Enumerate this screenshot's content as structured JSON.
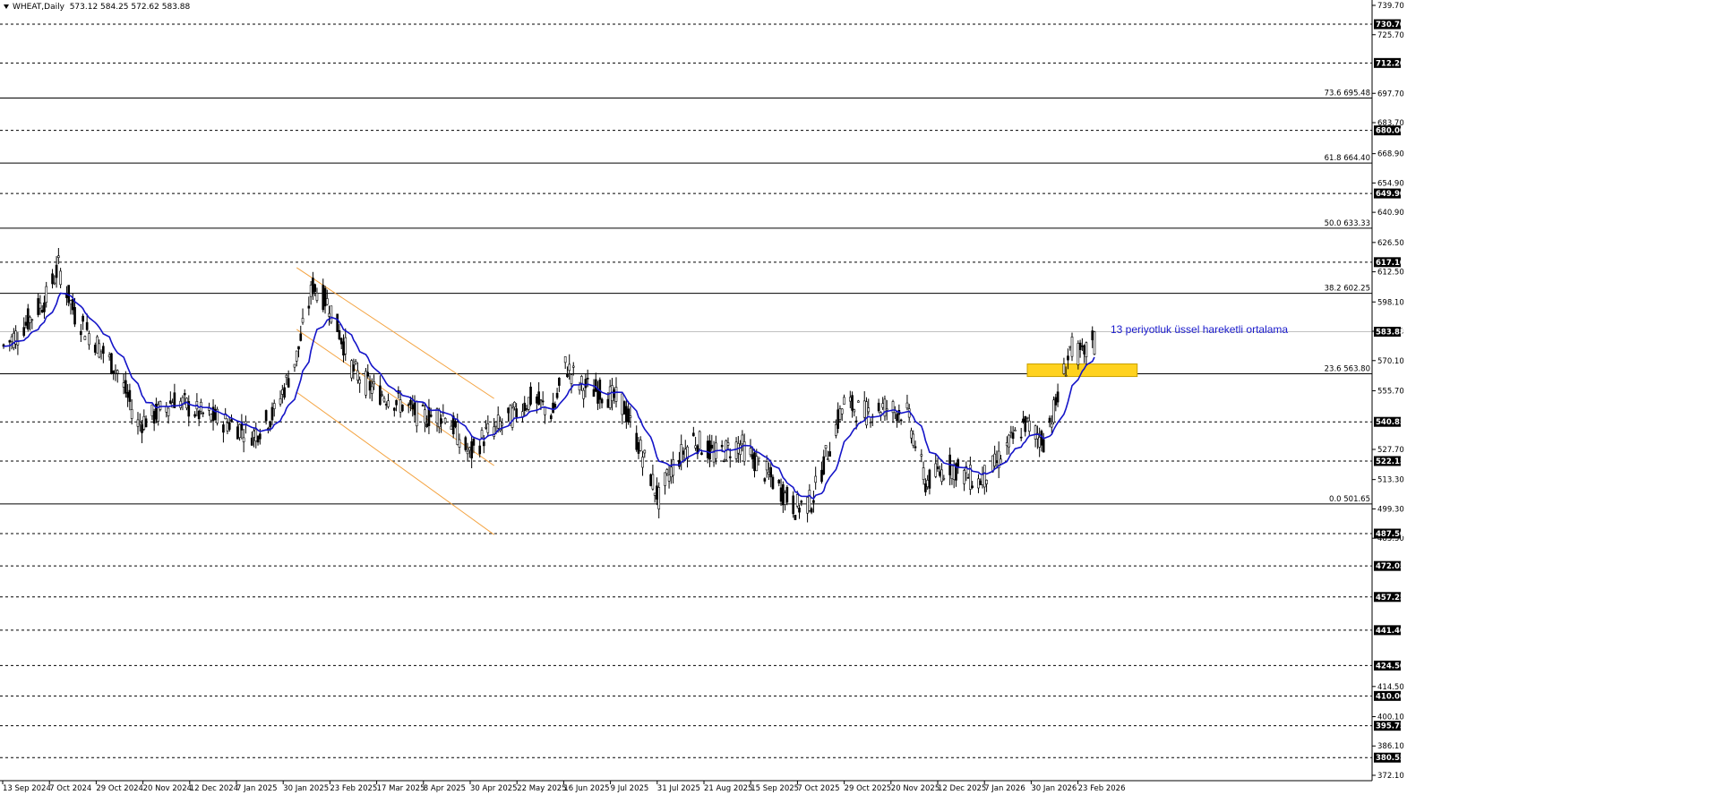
{
  "header": {
    "symbol": "WHEAT,Daily",
    "ohlc": "573.12 584.25 572.62 583.88"
  },
  "annotation": "13 periyotluk üssel hareketli ortalama",
  "colors": {
    "candles": "#000000",
    "ema": "#1414c8",
    "channel": "#f4a340",
    "zone_fill": "#ffd21f",
    "zone_border": "#c8a000",
    "tag_bg": "#000000"
  },
  "chart_data": {
    "type": "candlestick",
    "title": "WHEAT,Daily",
    "ylim": [
      372.1,
      739.7
    ],
    "y_ticks": [
      "739.70",
      "725.70",
      "697.70",
      "683.70",
      "668.90",
      "654.90",
      "640.90",
      "626.50",
      "612.50",
      "598.10",
      "584.10",
      "570.10",
      "555.70",
      "527.70",
      "513.30",
      "499.30",
      "485.30",
      "414.50",
      "400.10",
      "386.10",
      "372.10"
    ],
    "x_ticks": [
      "13 Sep 2024",
      "7 Oct 2024",
      "29 Oct 2024",
      "20 Nov 2024",
      "12 Dec 2024",
      "7 Jan 2025",
      "30 Jan 2025",
      "23 Feb 2025",
      "17 Mar 2025",
      "8 Apr 2025",
      "30 Apr 2025",
      "22 May 2025",
      "16 Jun 2025",
      "9 Jul 2025",
      "31 Jul 2025",
      "21 Aug 2025",
      "15 Sep 2025",
      "7 Oct 2025",
      "29 Oct 2025",
      "20 Nov 2025",
      "12 Dec 2025",
      "7 Jan 2026",
      "30 Jan 2026",
      "23 Feb 2026"
    ],
    "dashed_levels": [
      "730.70",
      "712.20",
      "680.00",
      "649.90",
      "617.10",
      "540.85",
      "522.15",
      "487.50",
      "472.05",
      "457.25",
      "441.40",
      "424.50",
      "410.00",
      "395.75",
      "380.55"
    ],
    "fib_levels": [
      {
        "label": "73.6 695.48",
        "value": 695.48
      },
      {
        "label": "61.8 664.40",
        "value": 664.4
      },
      {
        "label": "50.0 633.33",
        "value": 633.33
      },
      {
        "label": "38.2 602.25",
        "value": 602.25
      },
      {
        "label": "23.6 563.80",
        "value": 563.8
      },
      {
        "label": "0.0 501.65",
        "value": 501.65
      }
    ],
    "current_price": "583.88",
    "support_zone": {
      "low": 562.5,
      "high": 568.5,
      "start_date": "2026-01-29",
      "end_date": "2026-03-24"
    },
    "channel": {
      "upper": [
        [
          "2025-02-04",
          614.5
        ],
        [
          "2025-05-12",
          552.0
        ]
      ],
      "middle": [
        [
          "2025-02-04",
          585.0
        ],
        [
          "2025-05-12",
          520.0
        ]
      ],
      "lower": [
        [
          "2025-02-04",
          555.0
        ],
        [
          "2025-05-12",
          487.0
        ]
      ]
    },
    "ohlc_anchor": [
      [
        "2024-09-13",
        577
      ],
      [
        "2024-09-20",
        583
      ],
      [
        "2024-10-04",
        600
      ],
      [
        "2024-10-10",
        615
      ],
      [
        "2024-10-18",
        592
      ],
      [
        "2024-10-29",
        578
      ],
      [
        "2024-11-08",
        565
      ],
      [
        "2024-11-18",
        540
      ],
      [
        "2024-11-28",
        545
      ],
      [
        "2024-12-06",
        552
      ],
      [
        "2024-12-18",
        545
      ],
      [
        "2025-01-03",
        540
      ],
      [
        "2025-01-14",
        535
      ],
      [
        "2025-01-24",
        545
      ],
      [
        "2025-02-04",
        572
      ],
      [
        "2025-02-12",
        606
      ],
      [
        "2025-02-20",
        597
      ],
      [
        "2025-03-04",
        565
      ],
      [
        "2025-03-14",
        556
      ],
      [
        "2025-03-25",
        551
      ],
      [
        "2025-04-07",
        543
      ],
      [
        "2025-04-18",
        545
      ],
      [
        "2025-04-30",
        525
      ],
      [
        "2025-05-08",
        535
      ],
      [
        "2025-05-20",
        543
      ],
      [
        "2025-05-30",
        552
      ],
      [
        "2025-06-10",
        545
      ],
      [
        "2025-06-16",
        568
      ],
      [
        "2025-06-24",
        558
      ],
      [
        "2025-07-04",
        555
      ],
      [
        "2025-07-14",
        550
      ],
      [
        "2025-07-24",
        525
      ],
      [
        "2025-08-01",
        504
      ],
      [
        "2025-08-08",
        520
      ],
      [
        "2025-08-18",
        533
      ],
      [
        "2025-08-28",
        525
      ],
      [
        "2025-09-10",
        530
      ],
      [
        "2025-09-24",
        515
      ],
      [
        "2025-10-07",
        500
      ],
      [
        "2025-10-15",
        503
      ],
      [
        "2025-10-24",
        530
      ],
      [
        "2025-10-31",
        550
      ],
      [
        "2025-11-10",
        545
      ],
      [
        "2025-11-20",
        548
      ],
      [
        "2025-12-01",
        545
      ],
      [
        "2025-12-10",
        512
      ],
      [
        "2025-12-22",
        520
      ],
      [
        "2026-01-05",
        512
      ],
      [
        "2026-01-13",
        520
      ],
      [
        "2026-01-20",
        530
      ],
      [
        "2026-01-28",
        540
      ],
      [
        "2026-02-06",
        532
      ],
      [
        "2026-02-13",
        552
      ],
      [
        "2026-02-19",
        576
      ],
      [
        "2026-02-26",
        572
      ],
      [
        "2026-03-03",
        583.88
      ]
    ],
    "ema_period": 13
  }
}
